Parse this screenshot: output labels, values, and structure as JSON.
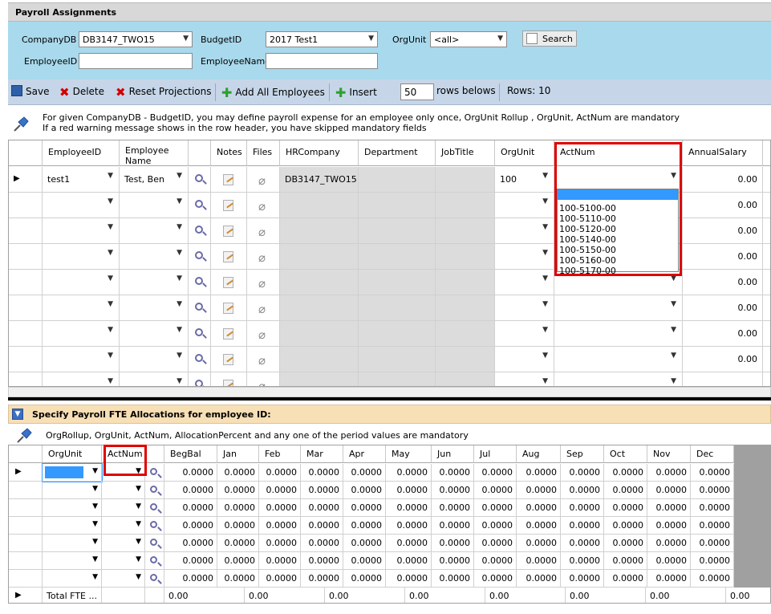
{
  "title": "Payroll Assignments",
  "filters": {
    "company_label": "CompanyDB",
    "company_value": "DB3147_TWO15",
    "budget_label": "BudgetID",
    "budget_value": "2017 Test1",
    "orgunit_label": "OrgUnit",
    "orgunit_value": "<all>",
    "search_label": "Search",
    "employee_id_label": "EmployeeID",
    "employee_name_label": "EmployeeName"
  },
  "toolbar": {
    "save": "Save",
    "delete": "Delete",
    "reset": "Reset Projections",
    "add_all": "Add All Employees",
    "insert": "Insert",
    "rows_count": "50",
    "rows_label": "rows belows",
    "rows_total": "Rows: 10"
  },
  "info": {
    "line1": "For given CompanyDB - BudgetID, you may define payroll expense for an employee only once, OrgUnit Rollup , OrgUnit, ActNum are mandatory",
    "line2": "If a red warning message shows in the row header, you have skipped mandatory fields"
  },
  "grid1": {
    "headers": [
      "EmployeeID",
      "Employee Name",
      "Notes",
      "Files",
      "HRCompany",
      "Department",
      "JobTitle",
      "OrgUnit",
      "ActNum",
      "AnnualSalary"
    ],
    "first_row": {
      "employee_id": "test1",
      "employee_name": "Test, Ben",
      "hr_company": "DB3147_TWO15",
      "org_unit": "100"
    },
    "salaries": [
      "0.00",
      "0.00",
      "0.00",
      "0.00",
      "0.00",
      "0.00",
      "0.00",
      "0.00"
    ]
  },
  "actnum_options": [
    "100-5100-00",
    "100-5110-00",
    "100-5120-00",
    "100-5140-00",
    "100-5150-00",
    "100-5160-00",
    "100-5170-00"
  ],
  "section2": {
    "title": "Specify Payroll FTE Allocations for employee ID:",
    "info": "OrgRollup, OrgUnit, ActNum, AllocationPercent and any one of the period values are mandatory",
    "headers": [
      "OrgUnit",
      "ActNum",
      "BegBal",
      "Jan",
      "Feb",
      "Mar",
      "Apr",
      "May",
      "Jun",
      "Jul",
      "Aug",
      "Sep",
      "Oct",
      "Nov",
      "Dec"
    ],
    "cell_value": "0.0000",
    "total_label": "Total FTE ...",
    "total_value": "0.00"
  },
  "colors": {
    "filter_bg": "#a9d9ec",
    "toolbar_bg": "#c6d6e8",
    "section_bg": "#f7dfb6",
    "highlight": "#e00000"
  }
}
